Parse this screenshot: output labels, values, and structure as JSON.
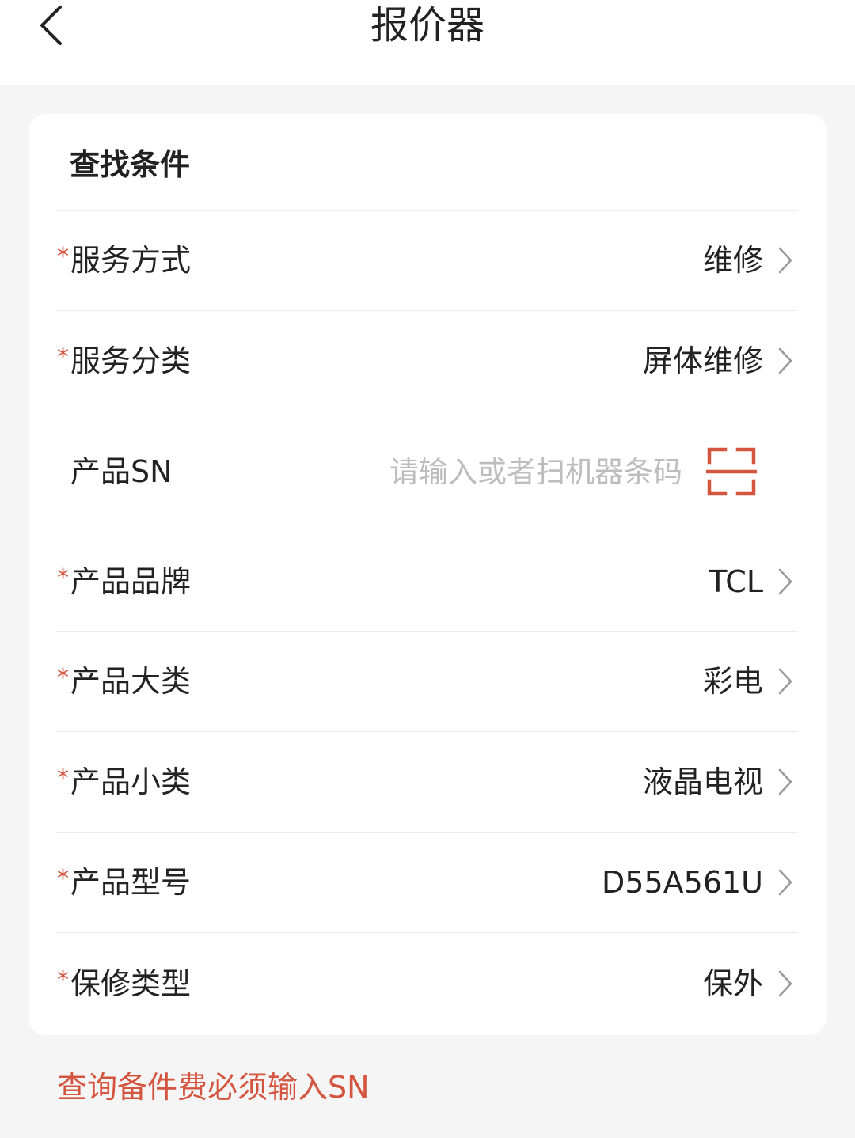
{
  "header": {
    "title": "报价器",
    "back_icon": "chevron-left-icon"
  },
  "card": {
    "title": "查找条件",
    "rows": [
      {
        "label": "服务方式",
        "required": true,
        "value": "维修"
      },
      {
        "label": "服务分类",
        "required": true,
        "value": "屏体维修"
      },
      {
        "label": "产品SN",
        "required": false,
        "value": "",
        "placeholder": "请输入或者扫机器条码",
        "icon": "scan-icon"
      },
      {
        "label": "产品品牌",
        "required": true,
        "value": "TCL"
      },
      {
        "label": "产品大类",
        "required": true,
        "value": "彩电"
      },
      {
        "label": "产品小类",
        "required": true,
        "value": "液晶电视"
      },
      {
        "label": "产品型号",
        "required": true,
        "value": "D55A561U"
      },
      {
        "label": "保修类型",
        "required": true,
        "value": "保外"
      }
    ]
  },
  "required_mark": "*",
  "notice": "查询备件费必须输入SN",
  "colors": {
    "accent": "#d4553f",
    "placeholder": "#bdbdbd",
    "background": "#f5f5f5",
    "card": "#ffffff"
  }
}
